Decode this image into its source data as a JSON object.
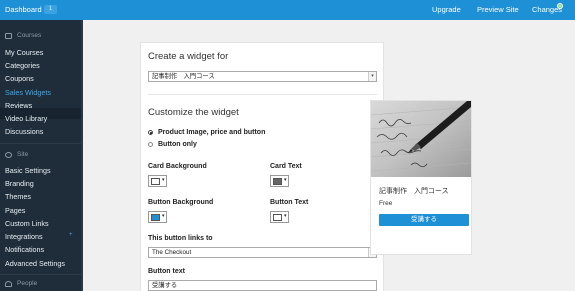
{
  "topbar": {
    "dashboard": "Dashboard",
    "badge": "1",
    "upgrade": "Upgrade",
    "preview_site": "Preview Site",
    "changes": "Changes",
    "changes_count": "0"
  },
  "sidebar": {
    "sections": {
      "courses": "Courses",
      "site": "Site",
      "people": "People"
    },
    "courses_items": [
      "My Courses",
      "Categories",
      "Coupons",
      "Sales Widgets",
      "Reviews",
      "Video Library",
      "Discussions"
    ],
    "site_items": [
      "Basic Settings",
      "Branding",
      "Themes",
      "Pages",
      "Custom Links",
      "Integrations",
      "Notifications",
      "Advanced Settings"
    ],
    "active_item": "Sales Widgets"
  },
  "form": {
    "create_heading": "Create a widget for",
    "course_select_value": "記事制作　入門コース",
    "customize_heading": "Customize the widget",
    "radio_options": [
      "Product Image, price and button",
      "Button only"
    ],
    "selected_option": "Product Image, price and button",
    "card_background_label": "Card Background",
    "card_text_label": "Card Text",
    "button_background_label": "Button Background",
    "button_text_label": "Button Text",
    "link_label": "This button links to",
    "link_select_value": "The Checkout",
    "button_text_field_label": "Button text",
    "button_text_value": "受講する"
  },
  "colors": {
    "card_background": "#ffffff",
    "card_text": "#666666",
    "button_background": "#1e90d6",
    "button_text": "#ffffff",
    "accent": "#1e90d6",
    "sidebar_bg": "#1f2d3a"
  },
  "preview": {
    "course_title": "記事制作　入門コース",
    "price": "Free",
    "button_label": "受講する",
    "image_icon": "fountain-pen-writing-photo"
  }
}
